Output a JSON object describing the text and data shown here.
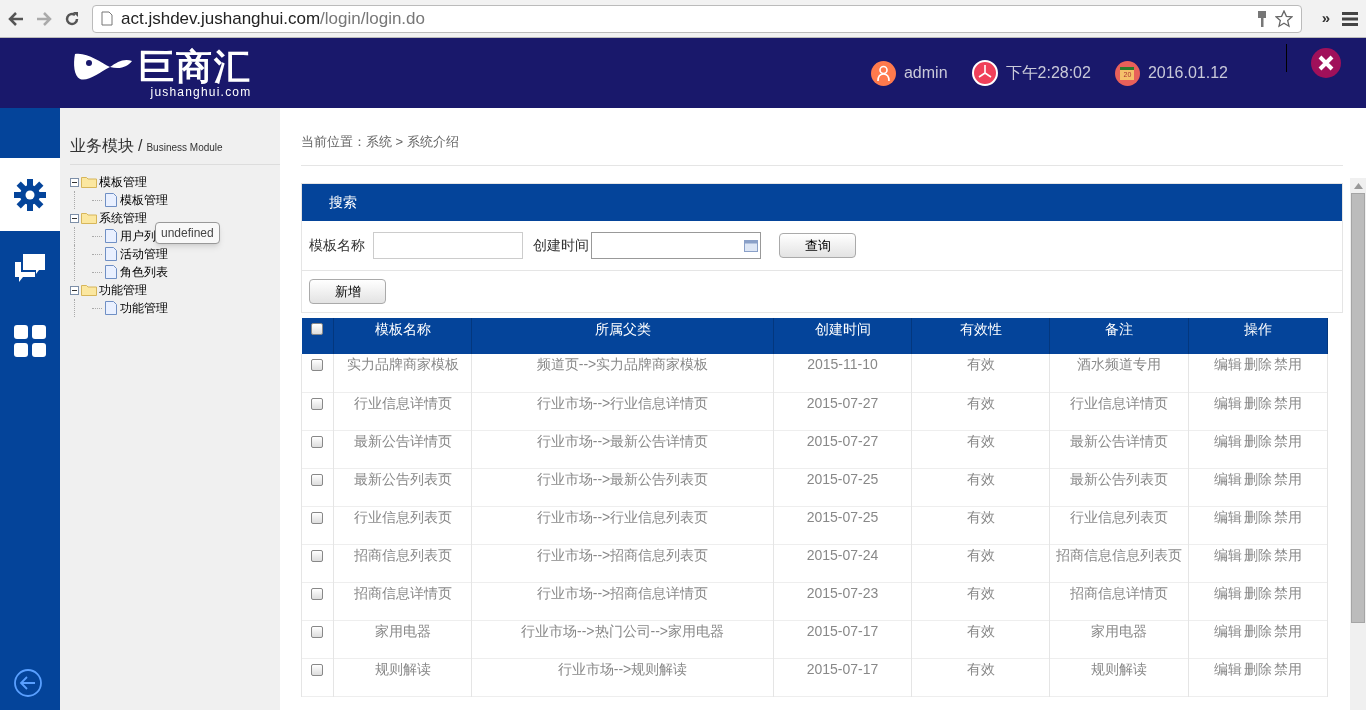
{
  "browser": {
    "url_host": "act.jshdev.jushanghui.com",
    "url_path": "/login/login.do",
    "overflow": "»"
  },
  "header": {
    "logo_text": "巨商汇",
    "logo_sub": "jushanghui.com",
    "user": "admin",
    "time": "下午2:28:02",
    "date": "2016.01.12",
    "calendar_day": "20"
  },
  "rail": [
    {
      "kind": "gear",
      "selected": true
    },
    {
      "kind": "chat",
      "selected": false
    },
    {
      "kind": "grid",
      "selected": false
    }
  ],
  "sidebar": {
    "title": "业务模块",
    "subtitle": "Business Module",
    "separator": "/",
    "tree": [
      {
        "label": "模板管理",
        "expanded": true,
        "children": [
          {
            "label": "模板管理"
          }
        ]
      },
      {
        "label": "系统管理",
        "expanded": true,
        "children": [
          {
            "label": "用户列"
          },
          {
            "label": "活动管理"
          },
          {
            "label": "角色列表"
          }
        ]
      },
      {
        "label": "功能管理",
        "expanded": true,
        "children": [
          {
            "label": "功能管理"
          }
        ]
      }
    ],
    "tooltip": "undefined"
  },
  "breadcrumb": "当前位置：系统 > 系统介绍",
  "search": {
    "title": "搜索",
    "fields": [
      {
        "label": "模板名称",
        "kind": "text"
      },
      {
        "label": "创建时间",
        "kind": "date"
      }
    ],
    "query_button": "查询",
    "add_button": "新增"
  },
  "table": {
    "all_checked": false,
    "columns": [
      "模板名称",
      "所属父类",
      "创建时间",
      "有效性",
      "备注",
      "操作"
    ],
    "rows": [
      {
        "checked": false,
        "cells": [
          "实力品牌商家模板",
          "频道页-->实力品牌商家模板",
          "2015-11-10",
          "有效",
          "酒水频道专用"
        ],
        "actions": [
          "编辑",
          "删除",
          "禁用"
        ]
      },
      {
        "checked": false,
        "cells": [
          "行业信息详情页",
          "行业市场-->行业信息详情页",
          "2015-07-27",
          "有效",
          "行业信息详情页"
        ],
        "actions": [
          "编辑",
          "删除",
          "禁用"
        ]
      },
      {
        "checked": false,
        "cells": [
          "最新公告详情页",
          "行业市场-->最新公告详情页",
          "2015-07-27",
          "有效",
          "最新公告详情页"
        ],
        "actions": [
          "编辑",
          "删除",
          "禁用"
        ]
      },
      {
        "checked": false,
        "cells": [
          "最新公告列表页",
          "行业市场-->最新公告列表页",
          "2015-07-25",
          "有效",
          "最新公告列表页"
        ],
        "actions": [
          "编辑",
          "删除",
          "禁用"
        ]
      },
      {
        "checked": false,
        "cells": [
          "行业信息列表页",
          "行业市场-->行业信息列表页",
          "2015-07-25",
          "有效",
          "行业信息列表页"
        ],
        "actions": [
          "编辑",
          "删除",
          "禁用"
        ]
      },
      {
        "checked": false,
        "cells": [
          "招商信息列表页",
          "行业市场-->招商信息列表页",
          "2015-07-24",
          "有效",
          "招商信息信息列表页"
        ],
        "actions": [
          "编辑",
          "删除",
          "禁用"
        ]
      },
      {
        "checked": false,
        "cells": [
          "招商信息详情页",
          "行业市场-->招商信息详情页",
          "2015-07-23",
          "有效",
          "招商信息详情页"
        ],
        "actions": [
          "编辑",
          "删除",
          "禁用"
        ]
      },
      {
        "checked": false,
        "cells": [
          "家用电器",
          "行业市场-->热门公司-->家用电器",
          "2015-07-17",
          "有效",
          "家用电器"
        ],
        "actions": [
          "编辑",
          "删除",
          "禁用"
        ]
      },
      {
        "checked": false,
        "cells": [
          "规则解读",
          "行业市场-->规则解读",
          "2015-07-17",
          "有效",
          "规则解读"
        ],
        "actions": [
          "编辑",
          "删除",
          "禁用"
        ]
      }
    ]
  }
}
